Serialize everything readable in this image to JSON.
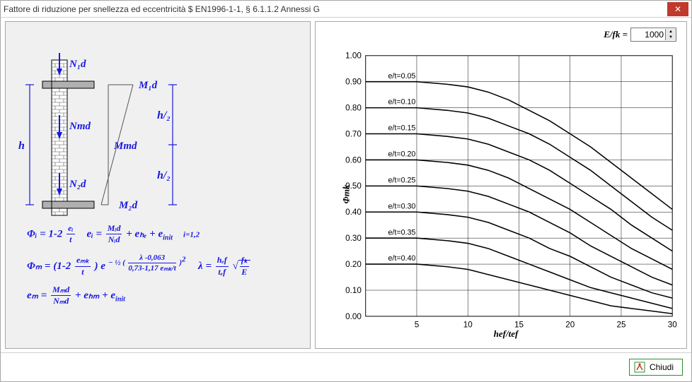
{
  "window": {
    "title": "Fattore di riduzione per snellezza ed eccentricità $ EN1996-1-1, § 6.1.1.2 Annessi G"
  },
  "footer": {
    "close_label": "Chiudi"
  },
  "controls": {
    "efk_label": "E/fk =",
    "efk_value": "1000"
  },
  "diagram": {
    "N1d": "N₁d",
    "N2d": "N₂d",
    "Nmd": "Nmd",
    "M1d": "M₁d",
    "M2d": "M₂d",
    "Mmd": "Mmd",
    "h": "h",
    "h2a": "h/₂",
    "h2b": "h/₂"
  },
  "formulas": {
    "phi_i_lhs": "Φᵢ = 1-2",
    "ei_over_t_num": "eᵢ",
    "ei_over_t_den": "t",
    "ei_eq": "eᵢ =",
    "Mid": "Mᵢd",
    "Nid": "Nᵢd",
    "plus_ehe": "+ eₕₑ + e",
    "init": "init",
    "i12": "i=1,2",
    "phi_m": "Φₘ = (1-2",
    "emk": "eₘₖ",
    "t2": "t",
    "close_e": ")  e",
    "exp_pre": "− ½ (",
    "exp_num": "λ -0,063",
    "exp_den": "0,73-1,17 eₘₖ/t",
    "exp_close": ")",
    "exp2": "2",
    "lambda": "λ =",
    "hef": "hₑf",
    "tef": "tₑf",
    "sqrt": "√",
    "fk": "fₖ",
    "E": "E",
    "em": "eₘ =",
    "Mmd": "Mₘd",
    "Nmd": "Nₘd",
    "plus_ehm": "+ eₕₘ + e"
  },
  "chart_data": {
    "type": "line",
    "xlabel": "hef/tef",
    "ylabel": "Φmk",
    "title": "",
    "xlim": [
      0,
      30
    ],
    "ylim": [
      0,
      1.0
    ],
    "xticks": [
      5,
      10,
      15,
      20,
      25,
      30
    ],
    "yticks": [
      0.0,
      0.1,
      0.2,
      0.3,
      0.4,
      0.5,
      0.6,
      0.7,
      0.8,
      0.9,
      1.0
    ],
    "series": [
      {
        "name": "e/t=0.05",
        "et": 0.05,
        "x": [
          0,
          5,
          8,
          10,
          12,
          14,
          16,
          18,
          20,
          22,
          24,
          26,
          28,
          30
        ],
        "y": [
          0.9,
          0.9,
          0.89,
          0.88,
          0.86,
          0.83,
          0.79,
          0.75,
          0.7,
          0.65,
          0.59,
          0.53,
          0.47,
          0.41
        ]
      },
      {
        "name": "e/t=0.10",
        "et": 0.1,
        "x": [
          0,
          5,
          8,
          10,
          12,
          14,
          16,
          18,
          20,
          22,
          24,
          26,
          28,
          30
        ],
        "y": [
          0.8,
          0.8,
          0.79,
          0.78,
          0.76,
          0.73,
          0.7,
          0.66,
          0.61,
          0.56,
          0.5,
          0.44,
          0.38,
          0.33
        ]
      },
      {
        "name": "e/t=0.15",
        "et": 0.15,
        "x": [
          0,
          5,
          8,
          10,
          12,
          14,
          16,
          18,
          20,
          22,
          24,
          26,
          28,
          30
        ],
        "y": [
          0.7,
          0.7,
          0.69,
          0.68,
          0.66,
          0.63,
          0.6,
          0.56,
          0.51,
          0.46,
          0.41,
          0.35,
          0.3,
          0.25
        ]
      },
      {
        "name": "e/t=0.20",
        "et": 0.2,
        "x": [
          0,
          5,
          8,
          10,
          12,
          14,
          16,
          18,
          20,
          22,
          24,
          26,
          28,
          30
        ],
        "y": [
          0.6,
          0.6,
          0.59,
          0.58,
          0.56,
          0.53,
          0.49,
          0.45,
          0.41,
          0.36,
          0.31,
          0.26,
          0.22,
          0.18
        ]
      },
      {
        "name": "e/t=0.25",
        "et": 0.25,
        "x": [
          0,
          5,
          8,
          10,
          12,
          14,
          16,
          18,
          20,
          22,
          24,
          26,
          28,
          30
        ],
        "y": [
          0.5,
          0.5,
          0.49,
          0.48,
          0.46,
          0.43,
          0.4,
          0.36,
          0.32,
          0.27,
          0.23,
          0.19,
          0.15,
          0.12
        ]
      },
      {
        "name": "e/t=0.30",
        "et": 0.3,
        "x": [
          0,
          5,
          8,
          10,
          12,
          14,
          16,
          18,
          20,
          22,
          24,
          26,
          28,
          30
        ],
        "y": [
          0.4,
          0.4,
          0.39,
          0.38,
          0.36,
          0.33,
          0.3,
          0.26,
          0.23,
          0.19,
          0.15,
          0.12,
          0.09,
          0.07
        ]
      },
      {
        "name": "e/t=0.35",
        "et": 0.35,
        "x": [
          0,
          5,
          8,
          10,
          12,
          14,
          16,
          18,
          20,
          22,
          24,
          26,
          28,
          30
        ],
        "y": [
          0.3,
          0.3,
          0.29,
          0.28,
          0.26,
          0.23,
          0.2,
          0.17,
          0.14,
          0.11,
          0.09,
          0.07,
          0.05,
          0.03
        ]
      },
      {
        "name": "e/t=0.40",
        "et": 0.4,
        "x": [
          0,
          5,
          8,
          10,
          12,
          14,
          16,
          18,
          20,
          22,
          24,
          26,
          28,
          30
        ],
        "y": [
          0.2,
          0.2,
          0.19,
          0.18,
          0.16,
          0.14,
          0.12,
          0.1,
          0.08,
          0.06,
          0.04,
          0.03,
          0.02,
          0.01
        ]
      }
    ]
  }
}
